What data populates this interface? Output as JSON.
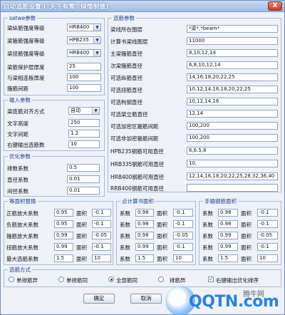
{
  "window": {
    "title": "自动选筋设置 (\"天下有雪\" 倾情制做)",
    "close_symbol": "X"
  },
  "satwe": {
    "title": "satwe参数",
    "rows": [
      {
        "label": "梁纵筋强度等级",
        "value": "HRB400"
      },
      {
        "label": "梁箍筋强度等级",
        "value": "HPB235"
      },
      {
        "label": "梁扭筋强度等级",
        "value": "HRB400"
      }
    ],
    "cover": {
      "label": "梁筋保护层厚度",
      "value": "25"
    },
    "support": {
      "label": "与梁相连板厚度",
      "value": "100"
    },
    "stirrup": {
      "label": "箍筋间距",
      "value": "100"
    }
  },
  "input": {
    "title": "输入参数",
    "align": {
      "label": "梁底筋对齐方式",
      "value": "自动"
    },
    "height": {
      "label": "文字高度",
      "value": "250"
    },
    "spacing": {
      "label": "文字间距",
      "value": "1.2"
    },
    "extra": {
      "label": "右键输出选筋数",
      "value": "10"
    }
  },
  "optimize": {
    "title": "优化参数",
    "rows": [
      {
        "label": "排数系数",
        "value": "0.5"
      },
      {
        "label": "直径系数",
        "value": "0.01"
      },
      {
        "label": "间径系数",
        "value": "0.01"
      }
    ]
  },
  "select": {
    "title": "选筋参数",
    "rows": [
      {
        "label": "梁线所在图层",
        "value": "*梁*,*beam*"
      },
      {
        "label": "计算书梁线图层",
        "value": "11000"
      },
      {
        "label": "主梁箍筋直径",
        "value": "8,10,12,14"
      },
      {
        "label": "次梁箍筋直径",
        "value": "6,8,10,12,14"
      },
      {
        "label": "可选纵筋直径",
        "value": "14,16,18,20,22,25"
      },
      {
        "label": "可选扭筋直径",
        "value": "10,12,14,16,18,20,22,25"
      },
      {
        "label": "可选构钢直径",
        "value": "10,12,14,16"
      },
      {
        "label": "可选架立筋直径",
        "value": "12,14"
      },
      {
        "label": "可选加密区箍筋间距",
        "value": "100,200"
      },
      {
        "label": "可选非加密箍筋间距",
        "value": "100,200"
      },
      {
        "label": "HPB235钢筋可用直径",
        "value": "6,6.5,8"
      },
      {
        "label": "HRB335钢筋可用直径",
        "value": "10,"
      },
      {
        "label": "HRB400钢筋可用直径",
        "value": "12,14,16,18,20,22,25,28,32,36,40"
      },
      {
        "label": "RRB400钢筋可用直径",
        "value": ""
      }
    ]
  },
  "equiv": {
    "title": "等面积替换",
    "area_label": "面积",
    "rows": [
      {
        "label": "正筋放大系数",
        "factor": "0.95",
        "area": "-0.1"
      },
      {
        "label": "负筋放大系数",
        "factor": "0.95",
        "area": "-0.1"
      },
      {
        "label": "箍筋放大系数",
        "factor": "0.99",
        "area": "-0.05"
      },
      {
        "label": "扭筋放大系数",
        "factor": "0.99",
        "area": "-0.1"
      },
      {
        "label": "最大选筋系数",
        "factor": "1.5",
        "area": "10"
      }
    ]
  },
  "calc": {
    "title": "点计算书面积",
    "coef_label": "系数",
    "area_label": "面积",
    "rows": [
      {
        "factor": "0.98",
        "area": "-0.1"
      },
      {
        "factor": "0.98",
        "area": "-0.1"
      },
      {
        "factor": "0.98",
        "area": "-0.05"
      },
      {
        "factor": "0.99",
        "area": "-0.1"
      },
      {
        "factor": "1.5",
        "area": "10"
      }
    ]
  },
  "manual": {
    "title": "手输钢筋面积",
    "coef_label": "系数",
    "area_label": "面积",
    "rows": [
      {
        "factor": "0.98",
        "area": "-0.1"
      },
      {
        "factor": "0.98",
        "area": "-0.1"
      },
      {
        "factor": "0.99",
        "area": "-0.05"
      },
      {
        "factor": "0.99",
        "area": "-0.1"
      },
      {
        "factor": "1.5",
        "area": "10"
      }
    ]
  },
  "method": {
    "title": "选筋方式",
    "options": [
      "单排筋异",
      "单排筋同",
      "全部筋同",
      "排筋异",
      "右键输出优化排序"
    ],
    "selected_index": 2,
    "checkbox_checked": true
  },
  "buttons": {
    "ok": "确定",
    "cancel": "取消"
  },
  "watermark": {
    "brand": "QQTN.com",
    "small": "腾牛网"
  }
}
